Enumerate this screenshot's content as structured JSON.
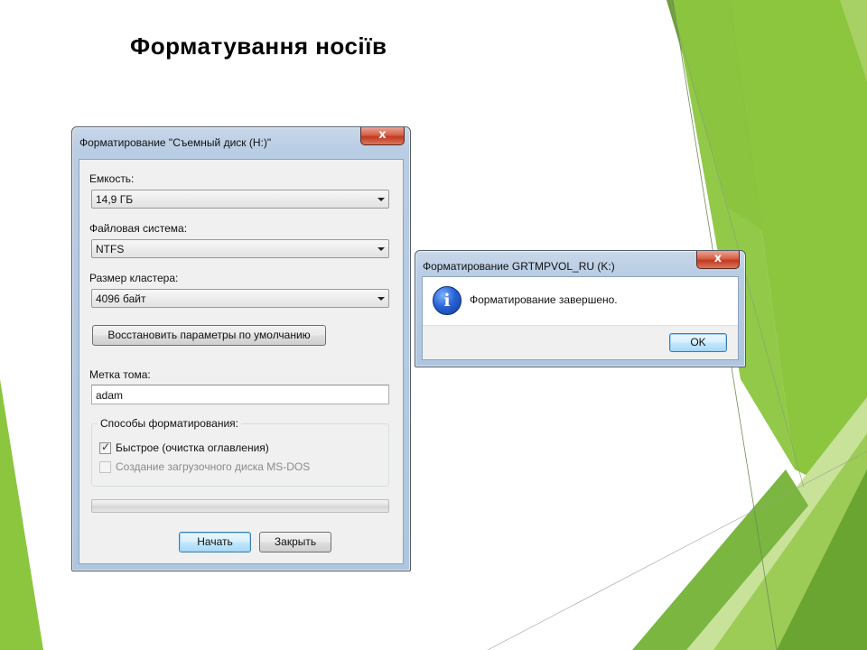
{
  "slide": {
    "title": "Форматування носіїв"
  },
  "format_dialog": {
    "title": "Форматирование \"Съемный диск (H:)\"",
    "close_glyph": "x",
    "capacity_label": "Емкость:",
    "capacity_value": "14,9 ГБ",
    "filesystem_label": "Файловая система:",
    "filesystem_value": "NTFS",
    "cluster_label": "Размер кластера:",
    "cluster_value": "4096 байт",
    "restore_defaults_label": "Восстановить параметры по умолчанию",
    "volume_label_label": "Метка тома:",
    "volume_label_value": "adam",
    "format_options_label": "Способы форматирования:",
    "quick_format_label": "Быстрое (очистка оглавления)",
    "quick_format_checked": true,
    "msdos_boot_label": "Создание загрузочного диска MS-DOS",
    "msdos_boot_checked": false,
    "progress_fraction": 0,
    "start_label": "Начать",
    "close_label": "Закрыть"
  },
  "message_box": {
    "title": "Форматирование GRTMPVOL_RU (K:)",
    "close_glyph": "x",
    "icon": "info-icon",
    "icon_glyph": "i",
    "message": "Форматирование завершено.",
    "ok_label": "OK"
  },
  "colors": {
    "accent_green": "#8cc63f",
    "dark_green": "#5a9a2a",
    "light_green": "#c8e29a",
    "default_button_border": "#3c7fb1",
    "info_icon_blue": "#2a63d6"
  }
}
